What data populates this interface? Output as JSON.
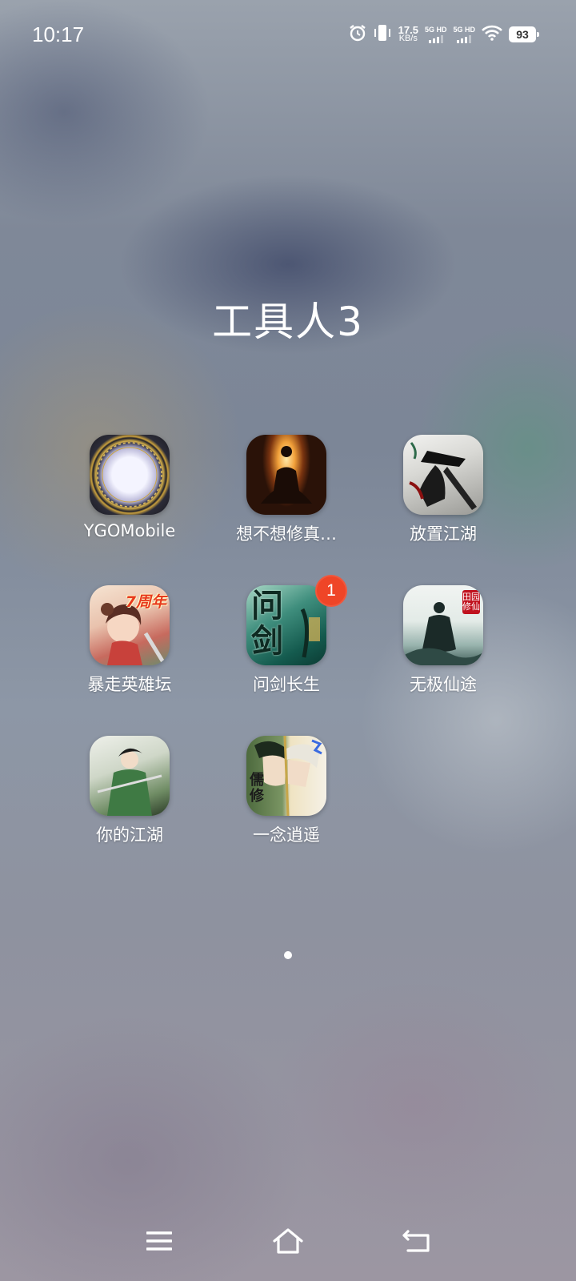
{
  "status_bar": {
    "time": "10:17",
    "net_speed_value": "17.5",
    "net_speed_unit": "KB/s",
    "sim1_label": "5G HD",
    "sim2_label": "5G HD",
    "battery": "93",
    "icons": [
      "alarm-icon",
      "vibrate-icon",
      "signal-icon",
      "wifi-icon",
      "battery-icon"
    ]
  },
  "folder": {
    "title": "工具人3",
    "apps": [
      {
        "label": "YGOMobile",
        "badge": ""
      },
      {
        "label": "想不想修真…",
        "badge": ""
      },
      {
        "label": "放置江湖",
        "badge": ""
      },
      {
        "label": "暴走英雄坛",
        "badge": "",
        "icon_text": "7周年"
      },
      {
        "label": "问剑长生",
        "badge": "1",
        "icon_text": "问剑"
      },
      {
        "label": "无极仙途",
        "badge": "",
        "icon_text": "田园修仙"
      },
      {
        "label": "你的江湖",
        "badge": ""
      },
      {
        "label": "一念逍遥",
        "badge": "",
        "icon_text": "儒修"
      }
    ]
  },
  "pagination": {
    "current": 1,
    "total": 1
  },
  "navbar": {
    "icons": [
      "menu-icon",
      "home-icon",
      "back-icon"
    ]
  }
}
